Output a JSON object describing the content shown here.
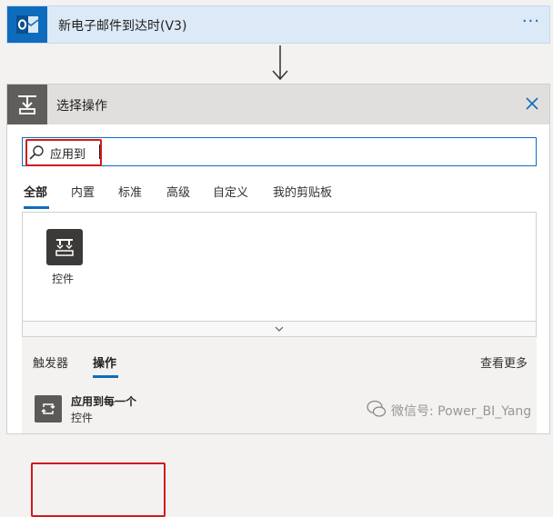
{
  "trigger": {
    "title": "新电子邮件到达时(V3)",
    "more": "···"
  },
  "picker": {
    "title": "选择操作",
    "search": {
      "value": "应用到"
    },
    "tabs": [
      "全部",
      "内置",
      "标准",
      "高级",
      "自定义",
      "我的剪贴板"
    ],
    "active_tab": "全部",
    "connectors": [
      {
        "label": "控件"
      }
    ],
    "results": {
      "tabs": [
        "触发器",
        "操作"
      ],
      "active_tab": "操作",
      "see_more": "查看更多",
      "items": [
        {
          "title": "应用到每一个",
          "subtitle": "控件"
        }
      ]
    }
  },
  "watermark": {
    "text": "微信号: Power_BI_Yang"
  },
  "colors": {
    "accent": "#0f6cbd",
    "highlight": "#d11a1a",
    "header_bg": "#e1dfdd"
  }
}
